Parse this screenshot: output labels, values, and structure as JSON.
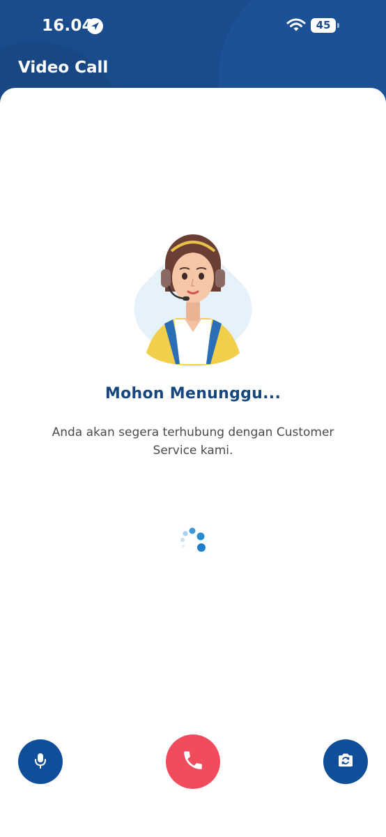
{
  "status_bar": {
    "time": "16.04",
    "battery": "45",
    "icons": [
      "location-arrow-icon",
      "wifi-icon",
      "battery-icon"
    ]
  },
  "header": {
    "title": "Video Call"
  },
  "main": {
    "illustration": "customer-service-agent-icon",
    "heading": "Mohon Menunggu...",
    "message": "Anda akan segera terhubung dengan Customer Service kami."
  },
  "controls": {
    "mic": "microphone-icon",
    "end_call": "phone-icon",
    "switch_camera": "camera-switch-icon"
  },
  "colors": {
    "header_bg": "#1a4b8c",
    "heading": "#17467e",
    "control_blue": "#0f4f9a",
    "end_call_red": "#f04c5e",
    "spinner": "#1e88d2"
  }
}
